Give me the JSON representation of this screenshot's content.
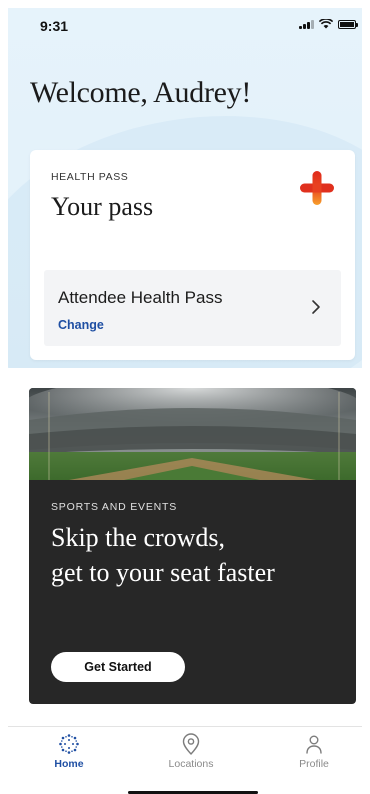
{
  "status_bar": {
    "time": "9:31"
  },
  "welcome": {
    "text": "Welcome, Audrey!"
  },
  "health_pass": {
    "eyebrow": "HEALTH PASS",
    "title": "Your pass",
    "row_title": "Attendee Health Pass",
    "change_label": "Change",
    "icon": "plus-icon"
  },
  "event_card": {
    "eyebrow": "SPORTS AND EVENTS",
    "title_line1": "Skip the crowds,",
    "title_line2": "get to your seat faster",
    "button_label": "Get Started",
    "image": "stadium-photo"
  },
  "tabs": [
    {
      "label": "Home",
      "icon": "home-dots-icon",
      "active": true
    },
    {
      "label": "Locations",
      "icon": "location-pin-icon",
      "active": false
    },
    {
      "label": "Profile",
      "icon": "person-icon",
      "active": false
    }
  ],
  "colors": {
    "accent": "#1f4fa3",
    "hero_bg": "#e4f2fa",
    "card_dark": "#272727",
    "plus_red": "#e23a1e",
    "plus_orange": "#f59a2c"
  }
}
